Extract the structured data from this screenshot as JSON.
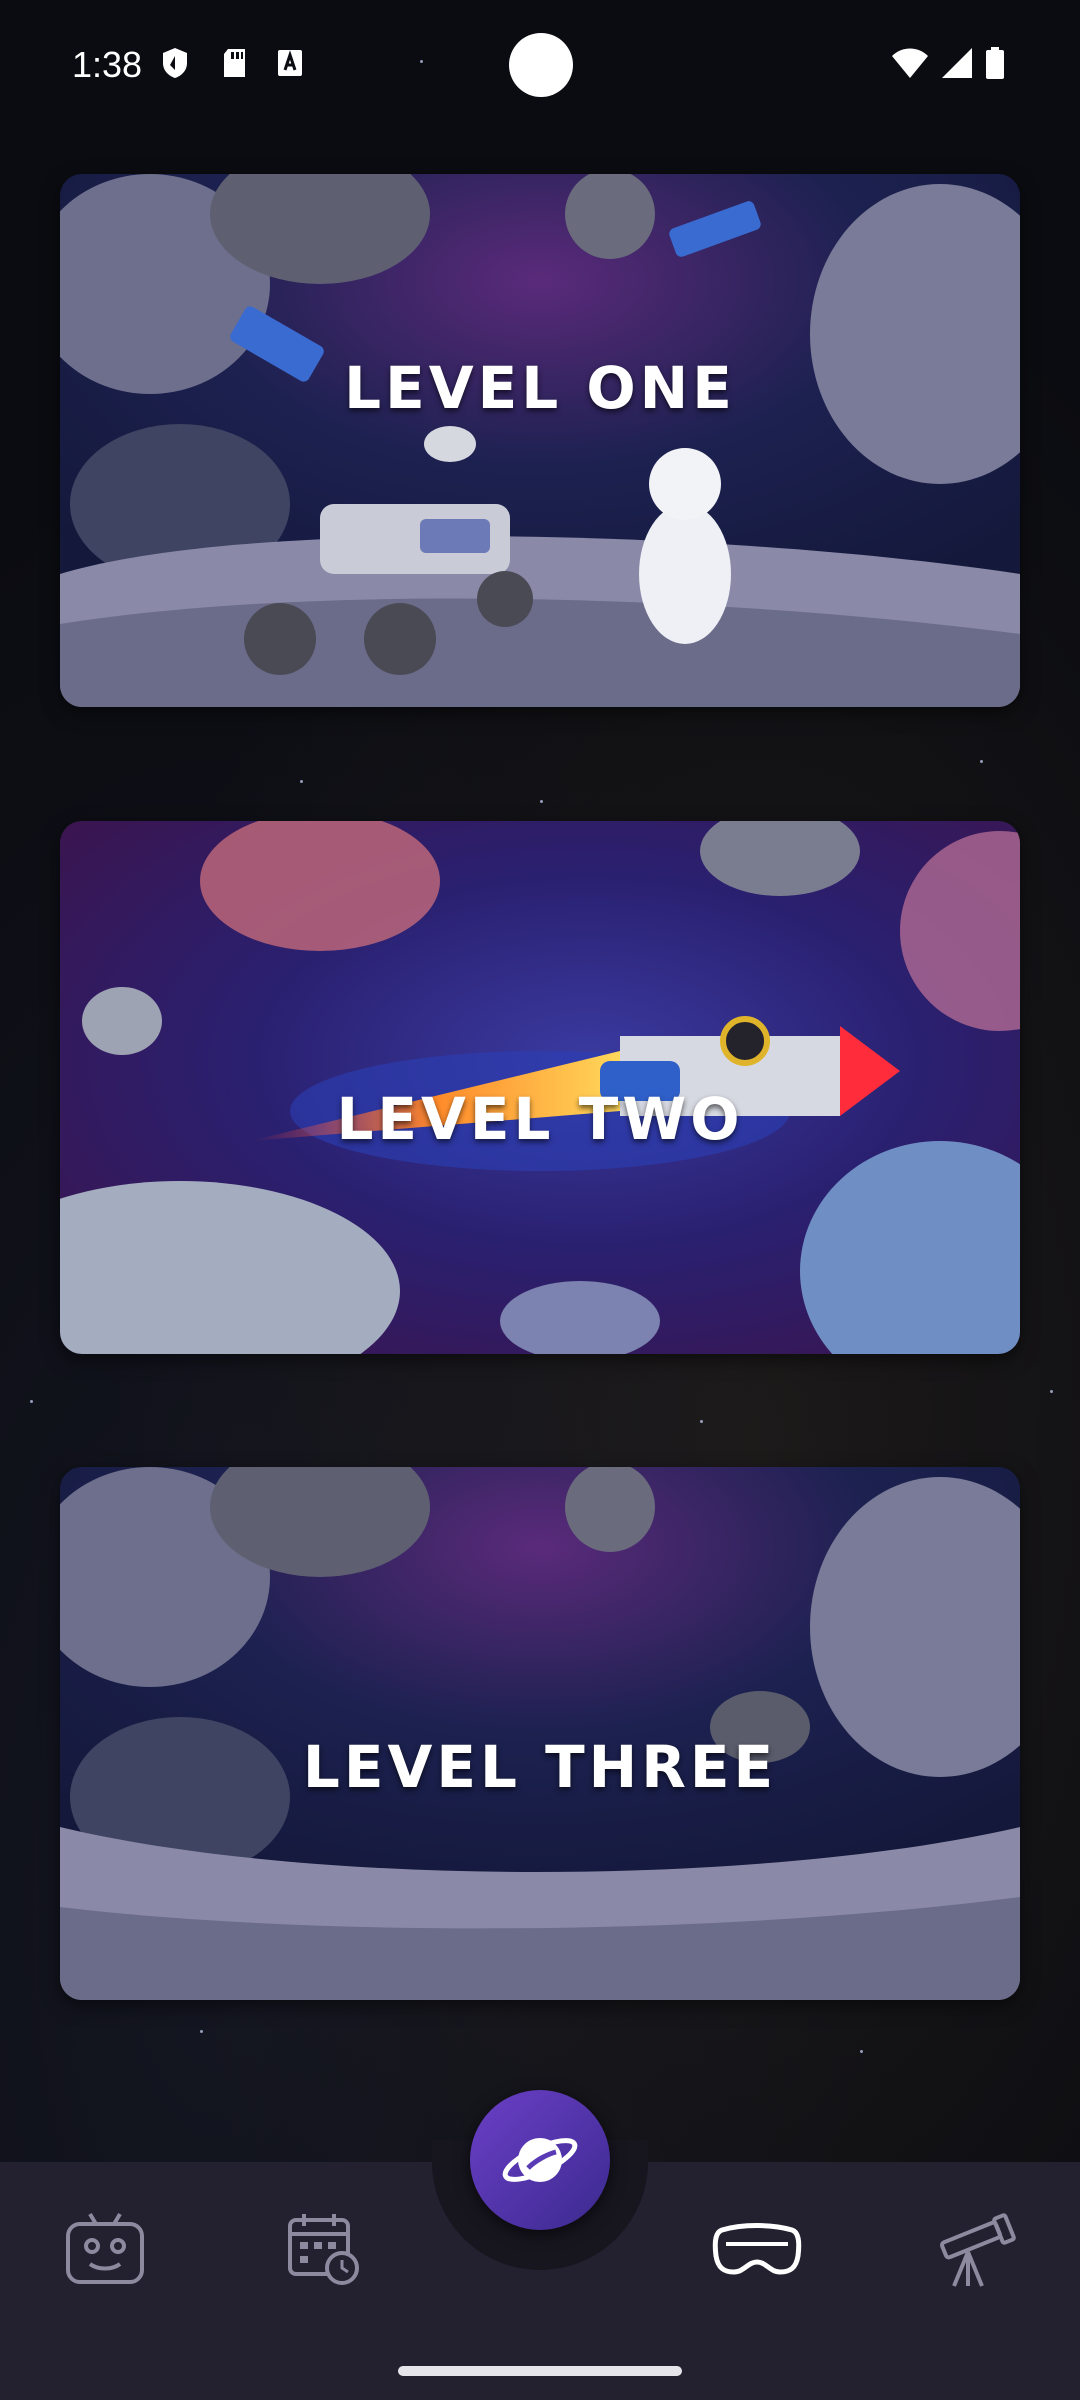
{
  "status_bar": {
    "time": "1:38",
    "icons": [
      "shield-icon",
      "sd-card-icon",
      "font-icon",
      "wifi-icon",
      "signal-icon",
      "battery-icon"
    ]
  },
  "levels": [
    {
      "label": "LEVEL ONE"
    },
    {
      "label": "LEVEL TWO"
    },
    {
      "label": "LEVEL THREE"
    }
  ],
  "nav": {
    "items": [
      "robot-icon",
      "calendar-clock-icon",
      "planet-icon",
      "vr-headset-icon",
      "telescope-icon"
    ],
    "active": "vr-headset-icon",
    "fab_icon": "planet-icon"
  },
  "colors": {
    "background": "#0b0c11",
    "nav_background": "#23202f",
    "fab_start": "#6b3fc7",
    "fab_end": "#3b2a8f",
    "label": "#ffffff"
  }
}
